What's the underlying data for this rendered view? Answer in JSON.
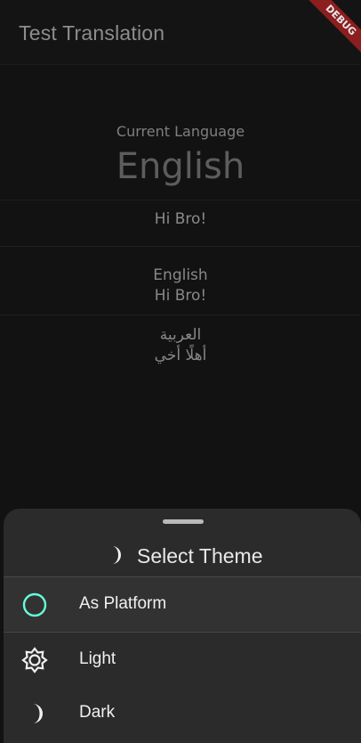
{
  "appbar": {
    "title": "Test Translation",
    "debug_banner": "DEBUG"
  },
  "main": {
    "current_language_label": "Current Language",
    "current_language": "English",
    "greeting": "Hi Bro!",
    "entries": [
      {
        "language": "English",
        "greeting": "Hi Bro!"
      },
      {
        "language": "العربية",
        "greeting": "أهلًا أخي"
      }
    ]
  },
  "theme_sheet": {
    "title": "Select Theme",
    "title_icon": "moon-icon",
    "options": [
      {
        "label": "As Platform",
        "icon": "circle-outline-icon",
        "selected": true
      },
      {
        "label": "Light",
        "icon": "sun-icon",
        "selected": false
      },
      {
        "label": "Dark",
        "icon": "moon-icon",
        "selected": false
      }
    ]
  },
  "colors": {
    "accent": "#64ffda",
    "sheet_background": "#2b2b2b",
    "debug_ribbon": "#8b1e1e"
  }
}
